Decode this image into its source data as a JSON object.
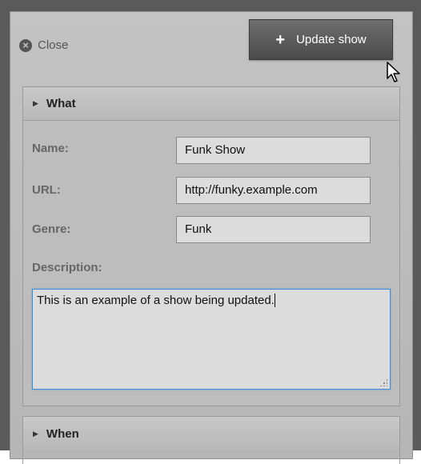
{
  "toolbar": {
    "close_label": "Close",
    "close_icon": "×",
    "update_label": "Update show",
    "update_icon": "+"
  },
  "sections": {
    "what": {
      "title": "What",
      "expanded": true
    },
    "when": {
      "title": "When",
      "expanded": false
    }
  },
  "form": {
    "name_label": "Name:",
    "name_value": "Funk Show",
    "url_label": "URL:",
    "url_value": "http://funky.example.com",
    "genre_label": "Genre:",
    "genre_value": "Funk",
    "description_label": "Description:",
    "description_value": "This is an example of a show being updated."
  },
  "colors": {
    "panel": "#bdbdbd",
    "button": "#555555",
    "focus_border": "#3b8bd9"
  }
}
